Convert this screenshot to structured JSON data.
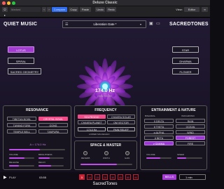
{
  "window": {
    "title": "Deluxe Classic"
  },
  "host": {
    "preset_value": "Marked",
    "compare": "Compare",
    "copy": "Copy",
    "paste": "Paste",
    "undo": "Undo",
    "redo": "Redo",
    "view_label": "View:",
    "view_value": "Editor"
  },
  "header": {
    "brand_left": "QUIET MUSIC",
    "brand_right": "SACREDTONES",
    "preset_name": "Liberation Gate *"
  },
  "left_buttons": [
    "LOTUS",
    "SPIRAL",
    "SACRED GEOMETRY"
  ],
  "right_buttons": [
    "STAR",
    "DHARMA",
    "FLOWER"
  ],
  "center": {
    "freq": "174.0 Hz",
    "sub": "PAIN RELIEF"
  },
  "resonance": {
    "title": "RESONANCE",
    "cells": [
      "TIBETAN BOWL",
      "CRYSTAL BOWL",
      "TUNING FORK",
      "GONG",
      "TEMPLE BELL",
      "TANPURA"
    ],
    "readout": "A = 174.0 Hz",
    "knobs": [
      "VOLUME",
      "BRIGHTNESS",
      "RELEASE",
      "DECAY"
    ]
  },
  "frequency": {
    "title": "FREQUENCY",
    "cells": [
      "SOLFEGGIO",
      "CHAKRA SOLAR",
      "CHAKRA PLANET",
      "OM VECTOR"
    ],
    "hz": "174.0 Hz",
    "hz_label": "PAIN RELIEF",
    "labels": [
      "LOWER SOLFEGGIO"
    ]
  },
  "space": {
    "title": "SPACE & MASTER",
    "knobs": [
      "REVERB",
      "WIDTH",
      "GAIN"
    ]
  },
  "entrainment": {
    "title": "ENTRAINMENT & NATURE",
    "left": [
      "δ DELTA",
      "θ THETA",
      "α ALPHA",
      "β BETA",
      "γ GAMMA"
    ],
    "right": [
      "RAIN",
      "OCEAN",
      "WIND",
      "FOREST",
      "FIRE"
    ],
    "tabs": [
      "BINAURAL",
      "ISOCHRONIC"
    ],
    "knobs": [
      "VOLUME",
      "SPEED"
    ]
  },
  "footer": {
    "play": "PLAY",
    "time": "03:55",
    "numbers": [
      "5",
      "10",
      "15",
      "20",
      "30",
      "45",
      "60",
      "90"
    ],
    "bells": "BELLS",
    "mins": "1 min",
    "brand": "SacredTones"
  },
  "colors": {
    "accent": "#a23cd0",
    "pink": "#f24b8a",
    "red": "#e33355"
  }
}
